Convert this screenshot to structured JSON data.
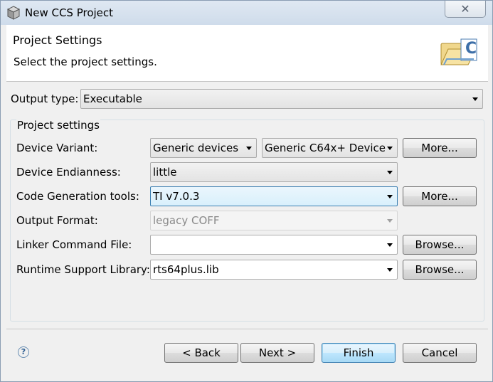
{
  "window": {
    "title": "New CCS Project",
    "close_glyph": "✕"
  },
  "header": {
    "title": "Project Settings",
    "subtitle": "Select the project settings.",
    "icon": "ccs-project-folder-icon"
  },
  "output_type": {
    "label": "Output type:",
    "value": "Executable"
  },
  "project_settings": {
    "group_label": "Project settings",
    "device_variant": {
      "label": "Device Variant:",
      "family": "Generic devices",
      "device": "Generic C64x+ Device",
      "more_label": "More..."
    },
    "device_endianness": {
      "label": "Device Endianness:",
      "value": "little"
    },
    "code_generation_tools": {
      "label": "Code Generation tools:",
      "value": "TI v7.0.3",
      "more_label": "More..."
    },
    "output_format": {
      "label": "Output Format:",
      "value": "legacy COFF"
    },
    "linker_command_file": {
      "label": "Linker Command File:",
      "value": "",
      "browse_label": "Browse..."
    },
    "runtime_support_library": {
      "label": "Runtime Support Library:",
      "value": "rts64plus.lib",
      "browse_label": "Browse..."
    }
  },
  "footer": {
    "help_glyph": "?",
    "back_label": "< Back",
    "next_label": "Next >",
    "finish_label": "Finish",
    "cancel_label": "Cancel"
  },
  "colors": {
    "accent": "#3c7fb1",
    "window_bg": "#f0f0f0",
    "header_bg": "#ffffff"
  }
}
